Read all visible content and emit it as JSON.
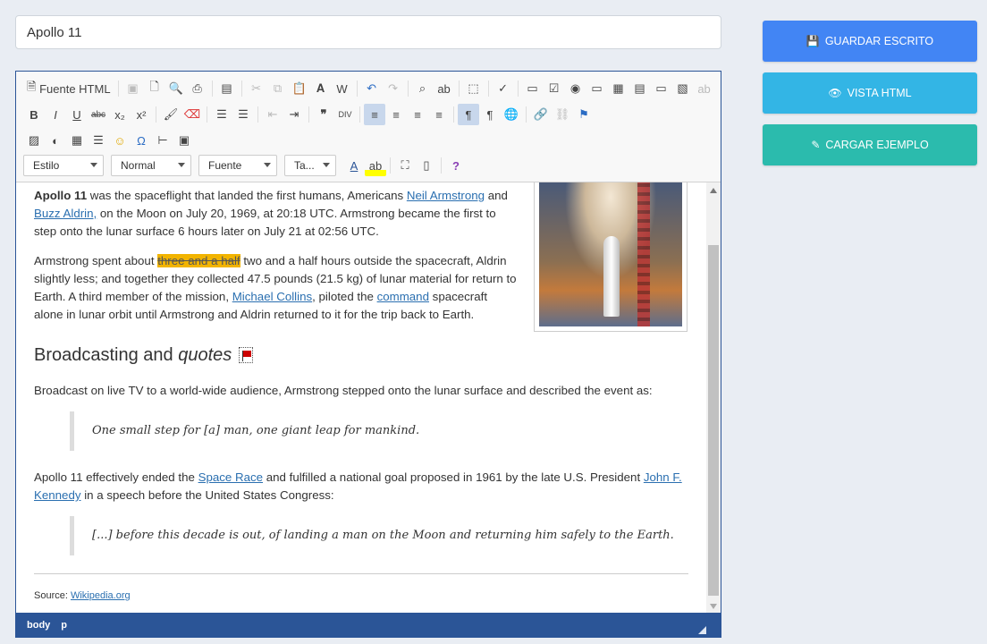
{
  "title_input": {
    "value": "Apollo 11"
  },
  "toolbar": {
    "source_label": "Fuente HTML",
    "combos": [
      "Estilo",
      "Normal",
      "Fuente",
      "Ta..."
    ]
  },
  "content": {
    "p1": {
      "strong": "Apollo 11",
      "t1": " was the spaceflight that landed the first humans, Americans ",
      "link1": "Neil Armstrong",
      "t2": " and ",
      "link2": "Buzz Aldrin,",
      "t3": " on the Moon on July 20, 1969, at 20:18 UTC. Armstrong became the first to step onto the lunar surface 6 hours later on July 21 at 02:56 UTC."
    },
    "p2": {
      "t1": "Armstrong spent about ",
      "strike": "three and a half",
      "t2": " two and a half hours outside the spacecraft, Aldrin slightly less; and together they collected 47.5 pounds (21.5 kg) of lunar material for return to Earth. A third member of the mission, ",
      "link1": "Michael Collins",
      "t3": ", piloted the ",
      "link2": "command",
      "t4": " spacecraft alone in lunar orbit until Armstrong and Aldrin returned to it for the trip back to Earth."
    },
    "heading": {
      "text": "Broadcasting and ",
      "em": "quotes"
    },
    "p3": "Broadcast on live TV to a world-wide audience, Armstrong stepped onto the lunar surface and described the event as:",
    "quote1": "One small step for [a] man, one giant leap for mankind.",
    "p4": {
      "t1": "Apollo 11 effectively ended the ",
      "link1": "Space Race",
      "t2": " and fulfilled a national goal proposed in 1961 by the late U.S. President ",
      "link2": "John F. Kennedy",
      "t3": " in a speech before the United States Congress:"
    },
    "quote2": "[...] before this decade is out, of landing a man on the Moon and returning him safely to the Earth.",
    "source": {
      "label": "Source: ",
      "link": "Wikipedia.org"
    }
  },
  "statusbar": {
    "path": [
      "body",
      "p"
    ]
  },
  "buttons": {
    "save": "GUARDAR ESCRITO",
    "view": "VISTA HTML",
    "load": "CARGAR EJEMPLO"
  },
  "colors": {
    "save": "#4285f4",
    "view": "#33b5e5",
    "load": "#2bbbad",
    "editor_border": "#2b5597"
  }
}
